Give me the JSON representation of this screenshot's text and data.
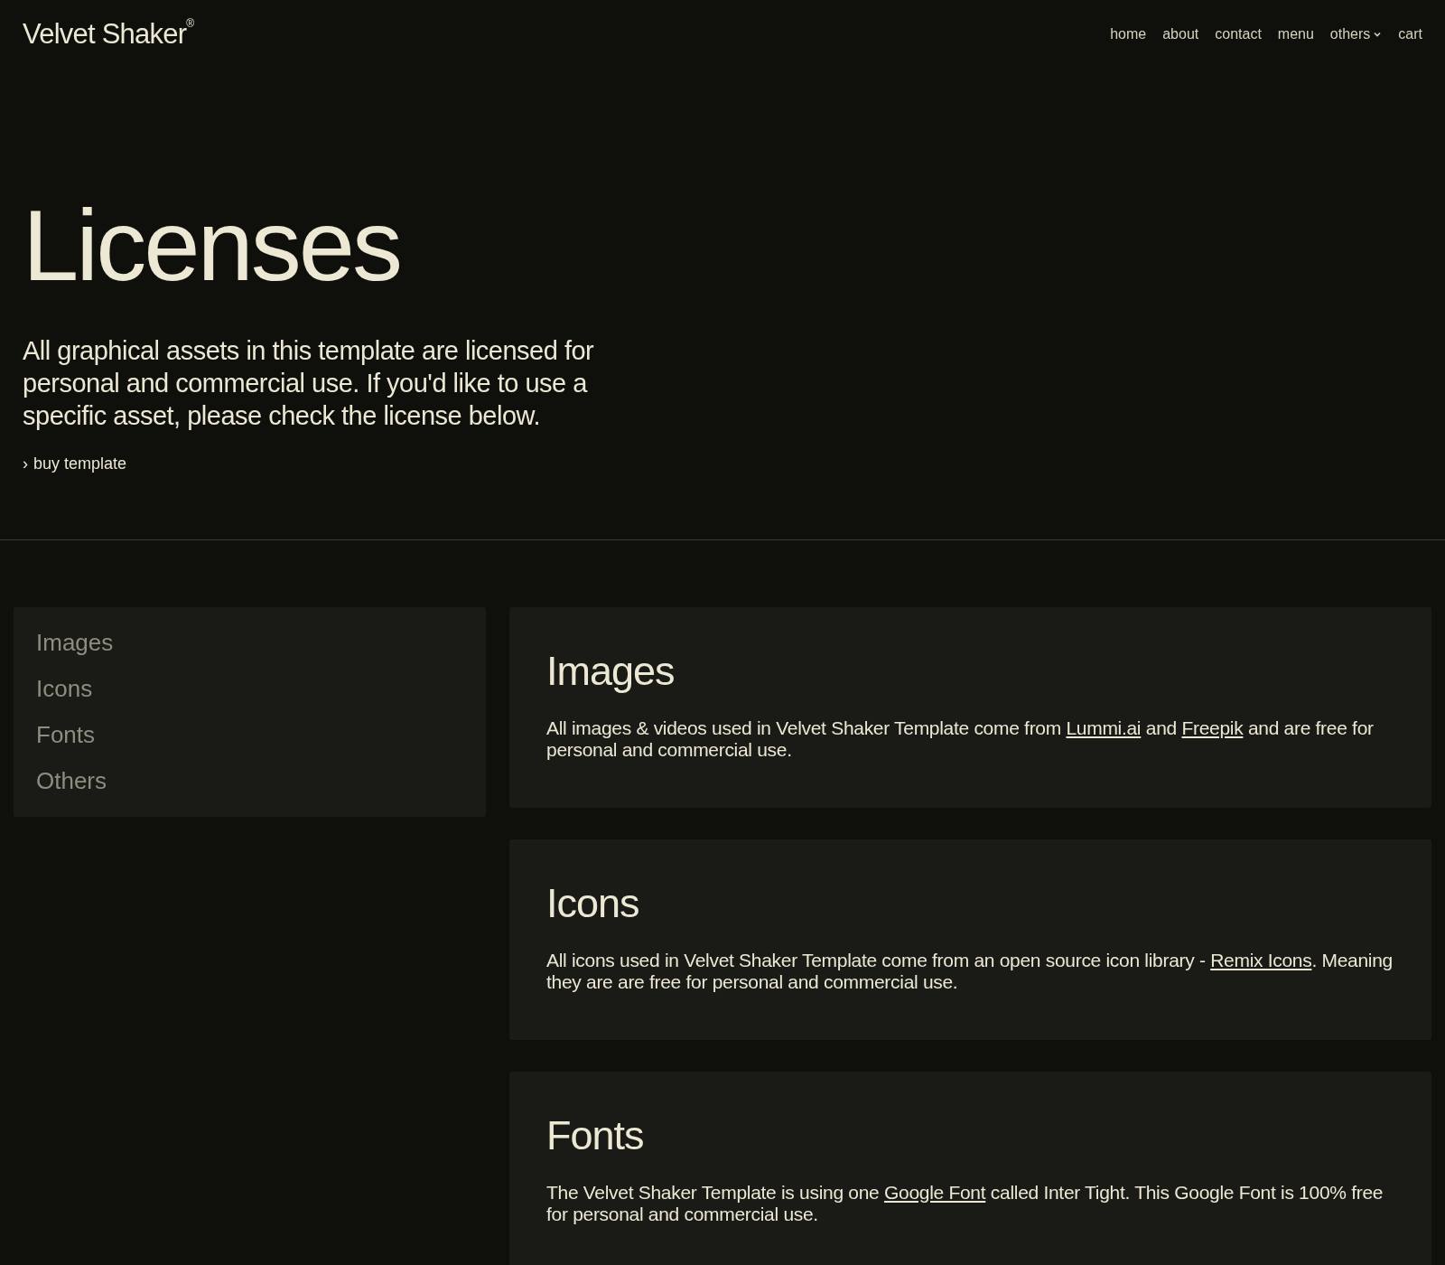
{
  "header": {
    "logo": "Velvet Shaker",
    "logo_mark": "®",
    "nav": [
      {
        "label": "home",
        "dropdown": false
      },
      {
        "label": "about",
        "dropdown": false
      },
      {
        "label": "contact",
        "dropdown": false
      },
      {
        "label": "menu",
        "dropdown": false
      },
      {
        "label": "others",
        "dropdown": true
      },
      {
        "label": "cart",
        "dropdown": false
      }
    ]
  },
  "hero": {
    "title": "Licenses",
    "intro": "All graphical assets in this template are licensed for personal and commercial use. If you'd like to use a specific asset, please check the license below.",
    "link_icon": "›",
    "link": "buy template"
  },
  "sidebar": {
    "items": [
      "Images",
      "Icons",
      "Fonts",
      "Others"
    ]
  },
  "sections": [
    {
      "title": "Images",
      "parts": [
        {
          "text": "All images & videos used in Velvet Shaker Template come from ",
          "link": false
        },
        {
          "text": "Lummi.ai",
          "link": true
        },
        {
          "text": " and ",
          "link": false
        },
        {
          "text": "Freepik",
          "link": true
        },
        {
          "text": " and are free for personal and commercial use.",
          "link": false
        }
      ]
    },
    {
      "title": "Icons",
      "parts": [
        {
          "text": "All icons used in Velvet Shaker Template come from an open source icon library - ",
          "link": false
        },
        {
          "text": "Remix Icons",
          "link": true
        },
        {
          "text": ". Meaning they are are free for personal and commercial use.",
          "link": false
        }
      ]
    },
    {
      "title": "Fonts",
      "parts": [
        {
          "text": "The Velvet Shaker Template is using one ",
          "link": false
        },
        {
          "text": "Google Font",
          "link": true
        },
        {
          "text": " called Inter Tight. This Google Font is 100% free for personal and commercial use.",
          "link": false
        }
      ]
    }
  ]
}
